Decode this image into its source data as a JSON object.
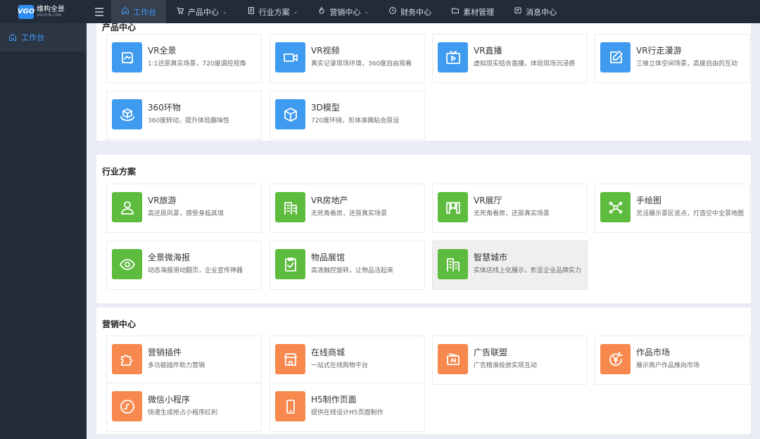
{
  "brand": {
    "mark": "VGO",
    "name_cn": "维构全景",
    "name_en": "VGOYUN.COM"
  },
  "topnav": [
    {
      "label": "工作台",
      "icon": "home-icon",
      "active": true,
      "dropdown": false
    },
    {
      "label": "产品中心",
      "icon": "cart-icon",
      "dropdown": true
    },
    {
      "label": "行业方案",
      "icon": "document-icon",
      "dropdown": true
    },
    {
      "label": "营销中心",
      "icon": "flame-icon",
      "dropdown": true
    },
    {
      "label": "财务中心",
      "icon": "clock-icon",
      "dropdown": false
    },
    {
      "label": "素材管理",
      "icon": "folder-icon",
      "dropdown": false
    },
    {
      "label": "消息中心",
      "icon": "message-icon",
      "dropdown": false
    }
  ],
  "sidebar": {
    "items": [
      {
        "label": "工作台",
        "icon": "home-icon"
      }
    ]
  },
  "sections": [
    {
      "title": "产品中心",
      "color": "#3e9bef",
      "cards": [
        {
          "title": "VR全景",
          "desc": "1:1还原真实场景，720度调控视角",
          "icon": "panorama-icon"
        },
        {
          "title": "VR视频",
          "desc": "真实记录现场环境，360度自由观看",
          "icon": "video-camera-icon"
        },
        {
          "title": "VR直播",
          "desc": "虚拟现实结合直播，体验现场沉浸感",
          "icon": "tv-play-icon"
        },
        {
          "title": "VR行走漫游",
          "desc": "三维立体空间场景，高度自由的互动",
          "icon": "edit-square-icon"
        },
        {
          "title": "360环物",
          "desc": "360度转动，提升体验趣味性",
          "icon": "cube-rotate-icon"
        },
        {
          "title": "3D模型",
          "desc": "720度环绕，形体准确贴合原设",
          "icon": "cube-icon"
        }
      ]
    },
    {
      "title": "行业方案",
      "color": "#5dbb3d",
      "cards": [
        {
          "title": "VR旅游",
          "desc": "高还原风景，感受身临其境",
          "icon": "person-icon"
        },
        {
          "title": "VR房地产",
          "desc": "无死角看房，还原真实场景",
          "icon": "building-icon"
        },
        {
          "title": "VR展厅",
          "desc": "无死角看房，还原真实场景",
          "icon": "exhibition-icon"
        },
        {
          "title": "手绘图",
          "desc": "灵活展示景区览点，打造空中全景地图",
          "icon": "nodes-icon"
        },
        {
          "title": "全景微海报",
          "desc": "动态海报滑动翻页，企业宣传神器",
          "icon": "eye-icon"
        },
        {
          "title": "物品展馆",
          "desc": "高清触控旋转，让物品活起来",
          "icon": "clipboard-check-icon"
        },
        {
          "title": "智慧城市",
          "desc": "实体店线上化展示，彰显企业品牌实力",
          "icon": "city-icon",
          "hover": true
        }
      ]
    },
    {
      "title": "营销中心",
      "color": "#f7884e",
      "cards": [
        {
          "title": "营销插件",
          "desc": "多功能插件助力营销",
          "icon": "puzzle-icon"
        },
        {
          "title": "在线商城",
          "desc": "一站式在线购物平台",
          "icon": "store-icon"
        },
        {
          "title": "广告联盟",
          "desc": "广告精准投放实现互动",
          "icon": "ad-card-icon"
        },
        {
          "title": "作品市场",
          "desc": "展示商户作品推向市场",
          "icon": "yen-refresh-icon"
        },
        {
          "title": "微信小程序",
          "desc": "快速生成抢占小程序红利",
          "icon": "miniprogram-icon"
        },
        {
          "title": "H5制作页面",
          "desc": "提供在线设计H5页面制作",
          "icon": "phone-icon"
        }
      ]
    }
  ]
}
